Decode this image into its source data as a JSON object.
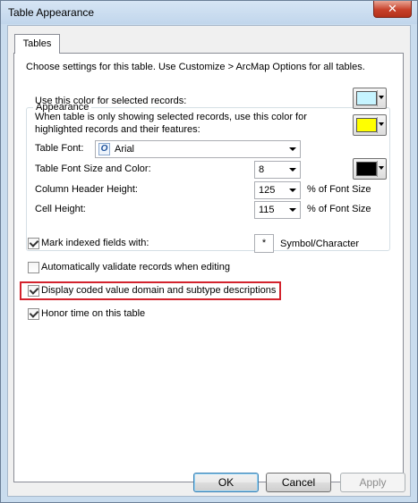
{
  "window": {
    "title": "Table Appearance",
    "close_symbol": "✕"
  },
  "tabs": [
    {
      "label": "Tables"
    }
  ],
  "intro_text": "Choose settings for this table. Use Customize > ArcMap Options for all tables.",
  "appearance": {
    "group_label": "Appearance",
    "selected_color_label": "Use this color for selected records:",
    "selected_color": "#c6f4ff",
    "highlight_color_label_line1": "When table is only showing selected records, use this color for",
    "highlight_color_label_line2": "highlighted records and their features:",
    "highlight_color": "#ffff00",
    "font_label": "Table Font:",
    "font_value": "Arial",
    "font_icon": "O",
    "font_size_label": "Table Font Size and Color:",
    "font_size_value": "8",
    "font_color": "#000000",
    "header_height_label": "Column Header Height:",
    "header_height_value": "125",
    "header_height_unit": "% of Font Size",
    "cell_height_label": "Cell Height:",
    "cell_height_value": "115",
    "cell_height_unit": "% of Font Size"
  },
  "options": {
    "mark_indexed_label": "Mark indexed fields with:",
    "mark_indexed_checked": true,
    "symbol_value": "*",
    "symbol_label": "Symbol/Character",
    "auto_validate_label": "Automatically validate records when editing",
    "auto_validate_checked": false,
    "coded_domain_label": "Display coded value domain and subtype descriptions",
    "coded_domain_checked": true,
    "honor_time_label": "Honor time on this table",
    "honor_time_checked": true
  },
  "buttons": {
    "ok": "OK",
    "cancel": "Cancel",
    "apply": "Apply"
  },
  "colors": {
    "highlight_border": "#d3232d",
    "title_bar": "#c9dcee"
  }
}
